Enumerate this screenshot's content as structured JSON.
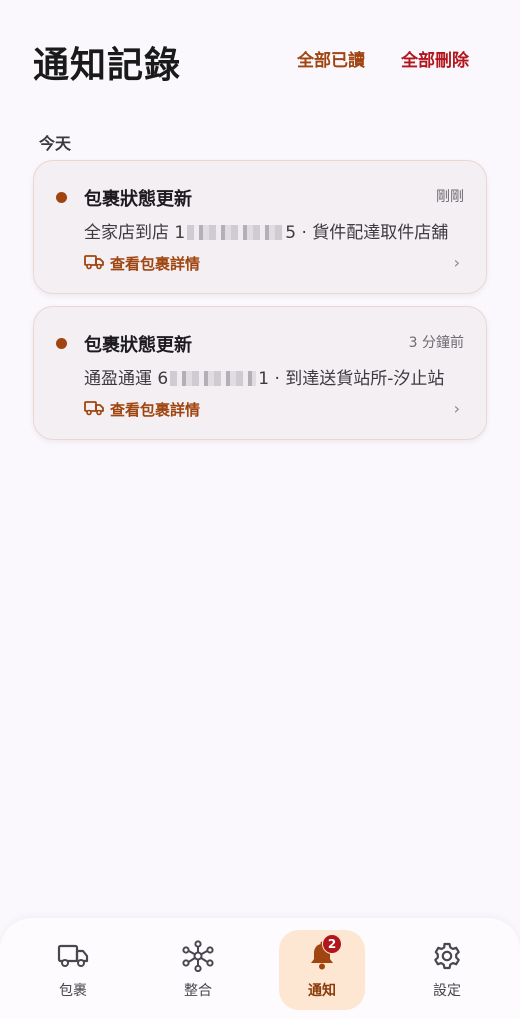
{
  "header": {
    "title": "通知記錄",
    "mark_all_read": "全部已讀",
    "delete_all": "全部刪除"
  },
  "section": {
    "today": "今天"
  },
  "notifications": [
    {
      "title": "包裹狀態更新",
      "time": "剛剛",
      "body_prefix": "全家店到店 1",
      "body_suffix": "5 · 貨件配達取件店舖",
      "link": "查看包裹詳情"
    },
    {
      "title": "包裹狀態更新",
      "time": "3 分鐘前",
      "body_prefix": "通盈通運 6",
      "body_suffix": "1 · 到達送貨站所-汐止站",
      "link": "查看包裹詳情"
    }
  ],
  "nav": {
    "items": [
      {
        "label": "包裹",
        "icon": "truck-icon"
      },
      {
        "label": "整合",
        "icon": "hub-icon"
      },
      {
        "label": "通知",
        "icon": "bell-icon",
        "badge": "2",
        "active": true
      },
      {
        "label": "設定",
        "icon": "gear-icon"
      }
    ]
  },
  "colors": {
    "accent": "#a0450f",
    "danger": "#b3151c",
    "background": "#faf7fd",
    "card": "#f3eff3",
    "active_nav": "#fde6d2"
  }
}
